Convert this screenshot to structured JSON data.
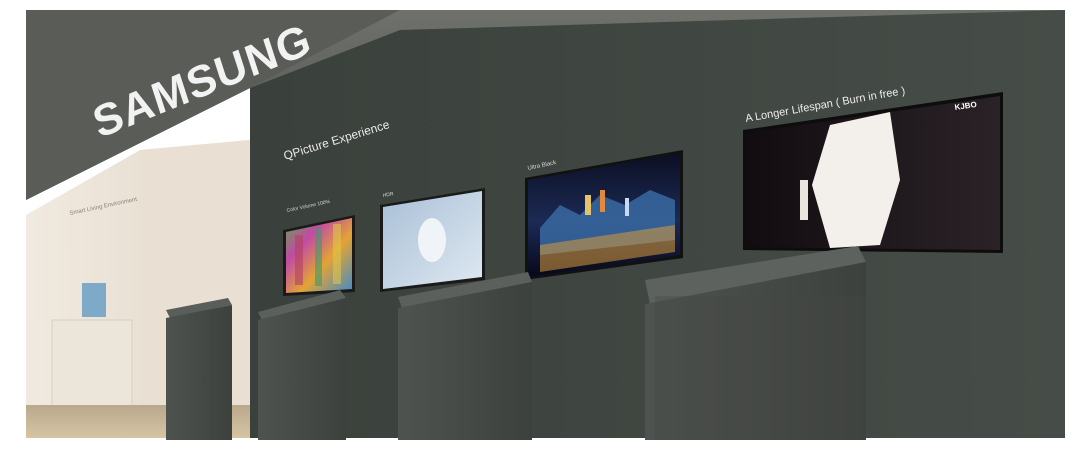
{
  "photo": {
    "brand": "SAMSUNG",
    "wall_heading": "QPicture Experience",
    "displays": [
      {
        "label": "Color Volume 100%"
      },
      {
        "label": "HDR"
      },
      {
        "label": "Ultra Black"
      },
      {
        "label": "A Longer Lifespan ( Burn in free )",
        "corner_logo": "KJBO"
      }
    ],
    "side_wall_text": "Smart Living Environment"
  },
  "colors": {
    "wall": "#3f4540",
    "wall_dark": "#323733",
    "ceiling": "#5c5e5a",
    "floor": "#c8b79a",
    "sign_white": "#f2f2f2"
  }
}
